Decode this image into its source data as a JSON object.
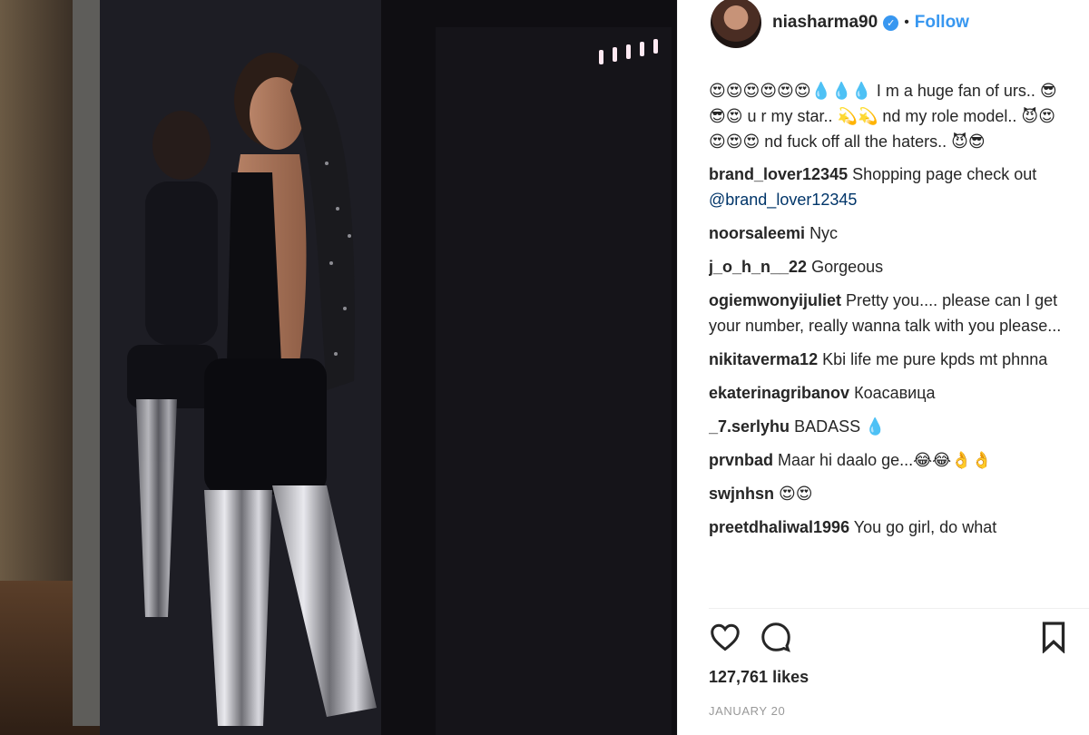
{
  "post": {
    "username": "niasharma90",
    "follow_label": "Follow",
    "dot": "•",
    "verified_glyph": "✓",
    "photo_alt": "Woman in black outfit and silver thigh-high boots posing beside a mirror",
    "caption": {
      "username": "",
      "text": "😍😍😍😍😍😍💧💧💧 I m a huge fan of urs.. 😎😎😍 u r my star.. 💫💫 nd my role model.. 😈😍😍😍😍 nd fuck off all the haters.. 😈😎"
    },
    "comments": [
      {
        "user": "brand_lover12345",
        "text": "Shopping page check out ",
        "mention": "@brand_lover12345"
      },
      {
        "user": "noorsaleemi",
        "text": "Nyc"
      },
      {
        "user": "j_o_h_n__22",
        "text": "Gorgeous"
      },
      {
        "user": "ogiemwonyijuliet",
        "text": "Pretty you.... please can I get your number, really wanna talk with you please..."
      },
      {
        "user": "nikitaverma12",
        "text": "Kbi life me pure kpds mt phnna"
      },
      {
        "user": "ekaterinagribanov",
        "text": "Коасавица"
      },
      {
        "user": "_7.serlyhu",
        "text": "BADASS 💧"
      },
      {
        "user": "prvnbad",
        "text": "Maar hi daalo ge...😂😂👌👌"
      },
      {
        "user": "swjnhsn",
        "text": "😍😍"
      },
      {
        "user": "preetdhaliwal1996",
        "text": "You go girl, do what"
      }
    ],
    "likes": "127,761 likes",
    "date": "JANUARY 20"
  },
  "icons": {
    "like": "heart-icon",
    "comment": "speech-bubble-icon",
    "save": "bookmark-icon",
    "verified": "verified-badge-icon"
  },
  "colors": {
    "accent": "#3897f0",
    "text": "#262626",
    "muted": "#999999"
  }
}
